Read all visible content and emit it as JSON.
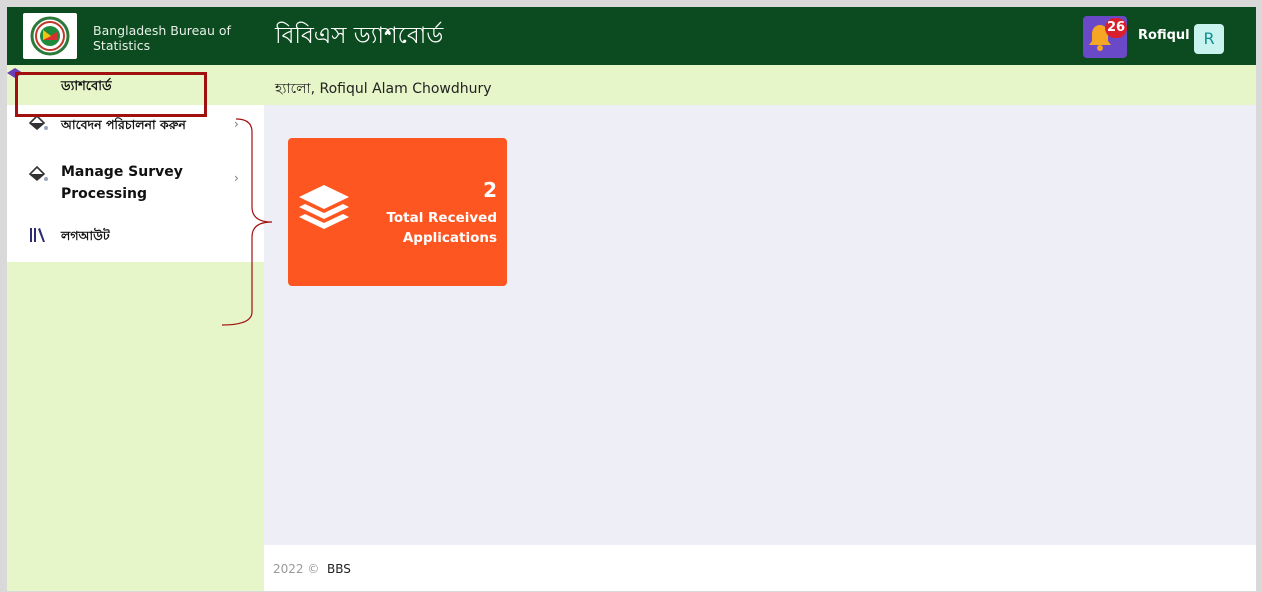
{
  "header": {
    "org_name": "Bangladesh Bureau of Statistics",
    "app_title": "বিবিএস ড্যাশবোর্ড",
    "notification_count": "26",
    "user_name": "Rofiqul",
    "avatar_initial": "R"
  },
  "sidebar": {
    "items": [
      {
        "label": "ড্যাশবোর্ড",
        "icon": "layers-icon"
      },
      {
        "label": "আবেদন পরিচালনা করুন",
        "icon": "fill-drip-icon",
        "chevron": "›"
      },
      {
        "label": "Manage Survey Processing",
        "icon": "fill-drip-icon",
        "chevron": "›"
      },
      {
        "label": "লগআউট",
        "icon": "library-icon"
      }
    ]
  },
  "main": {
    "greeting": "হ্যালো, Rofiqul Alam Chowdhury",
    "card": {
      "number": "2",
      "label": "Total Received Applications",
      "icon": "layers-icon"
    }
  },
  "footer": {
    "copyright": "2022 ©",
    "org": "BBS"
  },
  "colors": {
    "topbar": "#0b4b1f",
    "sidebar_bg": "#e6f6c8",
    "card_bg": "#fe5621",
    "notification_bg": "#6a49c9",
    "badge": "#d91f2b",
    "highlight_box": "#a20f0f"
  }
}
